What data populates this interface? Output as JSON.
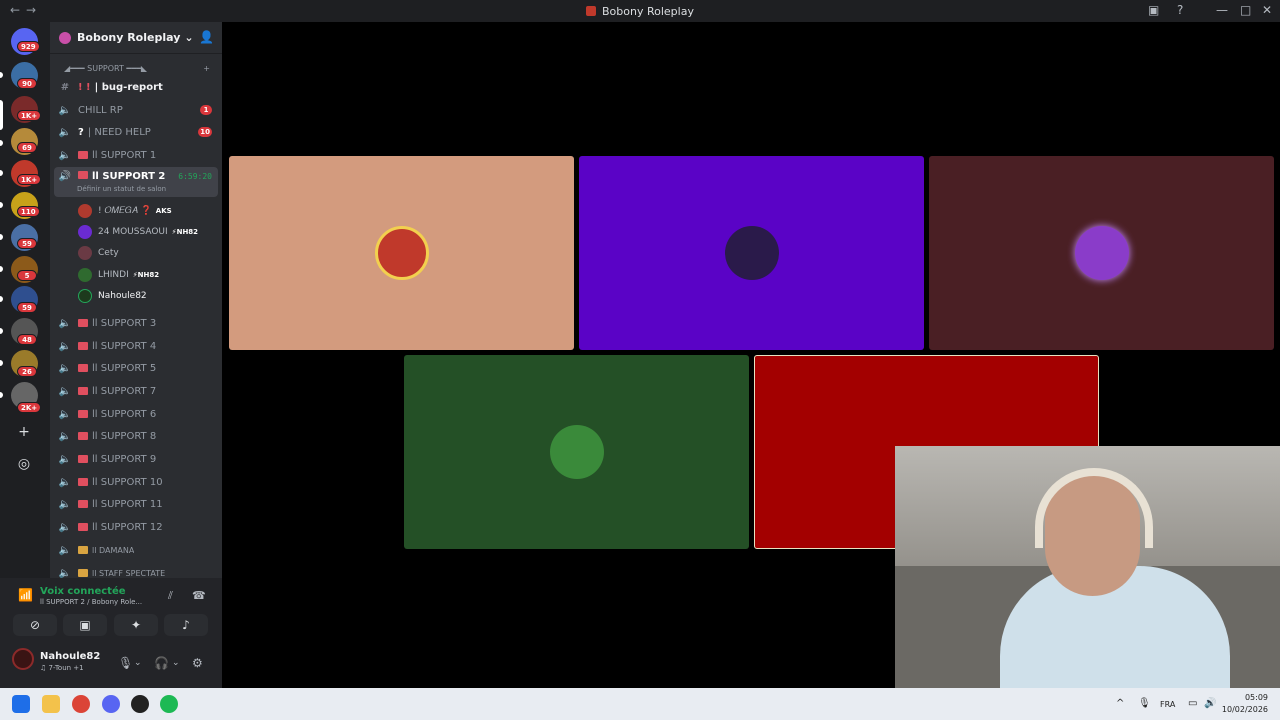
{
  "window": {
    "title": "Bobony Roleplay"
  },
  "guilds": [
    {
      "badge": "929",
      "color": "#5865f2"
    },
    {
      "badge": "90",
      "color": "#3b6ea5"
    },
    {
      "badge": "1K+",
      "color": "#7a2a2a"
    },
    {
      "badge": "69",
      "color": "#b58a3a"
    },
    {
      "badge": "1K+",
      "color": "#c0392b"
    },
    {
      "badge": "110",
      "color": "#c8a21a"
    },
    {
      "badge": "59",
      "color": "#4a6fa5"
    },
    {
      "badge": "5",
      "color": "#8c5a1a"
    },
    {
      "badge": "59",
      "color": "#2f4f8f"
    },
    {
      "badge": "48",
      "color": "#555"
    },
    {
      "badge": "26",
      "color": "#9a7b2a"
    },
    {
      "badge": "2K+",
      "color": "#666"
    }
  ],
  "server": {
    "name": "Bobony Roleplay"
  },
  "category": {
    "label": "◢━━━ SUPPORT ━━━◣"
  },
  "channels": {
    "bug_report": "| bug-report",
    "chill_rp": "CHILL RP",
    "chill_rp_badge": "1",
    "need_help": "| NEED HELP",
    "need_help_badge": "10",
    "support1": "ll SUPPORT 1",
    "support2": "ll SUPPORT 2",
    "support2_timer": "6:59:20",
    "support2_status": "Définir un statut de salon",
    "support3": "ll SUPPORT 3",
    "support4": "ll SUPPORT 4",
    "support5": "ll SUPPORT 5",
    "support7": "ll SUPPORT 7",
    "support6": "ll SUPPORT 6",
    "support8": "ll SUPPORT 8",
    "support9": "ll SUPPORT 9",
    "support10": "ll SUPPORT 10",
    "support11": "ll SUPPORT 11",
    "support12": "ll SUPPORT 12",
    "damana": "ll DAMANA",
    "staff_spectate": "ll STAFF SPECTATE"
  },
  "members": [
    {
      "name": "! 𝑂𝑀𝐸𝐺𝐴 ❓",
      "tag": "AKS",
      "color": "#b03a2e"
    },
    {
      "name": "24 MOUSSAOUI",
      "tag": "⚡NH82",
      "color": "#6a2bd1"
    },
    {
      "name": "Cety",
      "tag": "",
      "color": "#6a3a44"
    },
    {
      "name": "LHINDI",
      "tag": "⚡NH82",
      "color": "#2f6a2f"
    },
    {
      "name": "Nahoule82",
      "tag": "",
      "color": "#1d3a1d"
    }
  ],
  "voice": {
    "status": "Voix connectée",
    "channel": "ll SUPPORT 2 / Bobony Role..."
  },
  "user": {
    "name": "Nahoule82",
    "status": "♫ 7-Toun +1"
  },
  "tiles": [
    {
      "color": "#d39b7e",
      "avatar": "#c0392b"
    },
    {
      "color": "#5a03c6",
      "avatar": "#2a1a4a"
    },
    {
      "color": "#4a1f24",
      "avatar": "#8a3cc9"
    },
    {
      "color": "#245026",
      "avatar": "#3a8a3a"
    },
    {
      "color": "#a30000",
      "avatar": ""
    }
  ],
  "taskbar": {
    "lang": "FRA",
    "time": "05:09",
    "date": "10/02/2026"
  }
}
